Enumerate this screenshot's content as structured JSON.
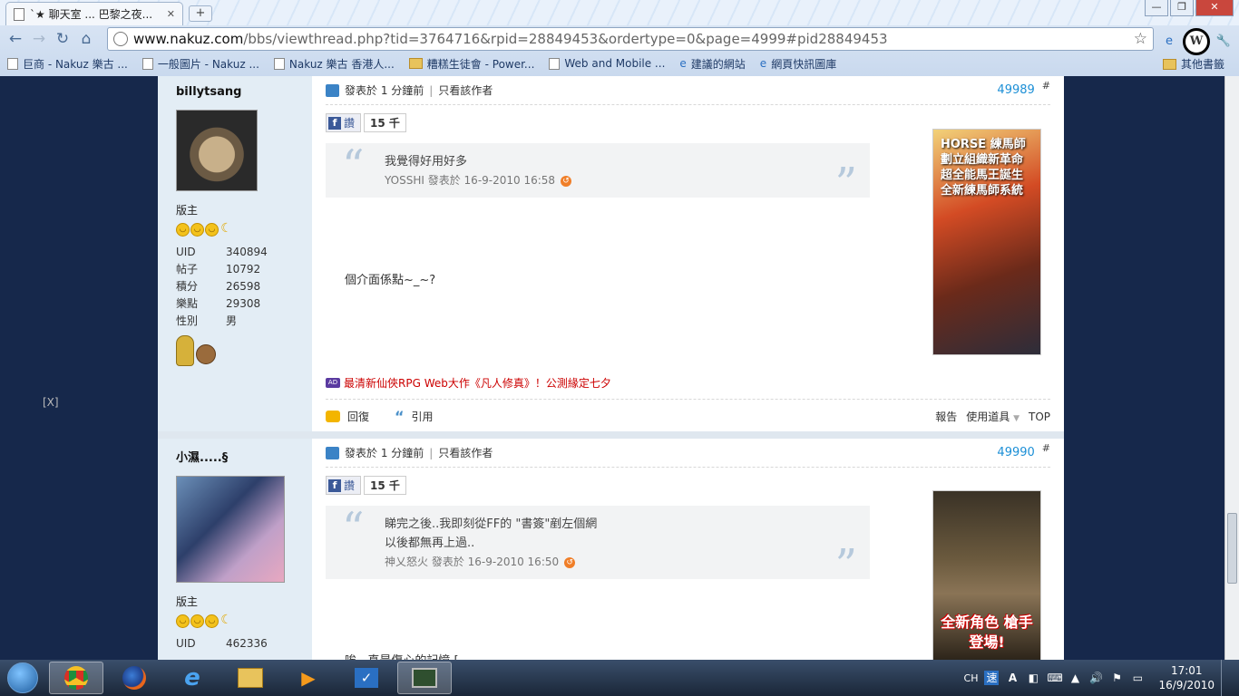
{
  "browser": {
    "tab_title": "`★ 聊天室 ... 巴黎之夜...",
    "url_host": "www.nakuz.com",
    "url_path": "/bbs/viewthread.php?tid=3764716&rpid=28849453&ordertype=0&page=4999#pid28849453",
    "bookmarks": [
      "巨商 - Nakuz 樂古 ...",
      "一般圖片 - Nakuz ...",
      "Nakuz 樂古 香港人...",
      "糟糕生徒會 - Power...",
      "Web and Mobile ...",
      "建議的網站",
      "網頁快訊圖庫"
    ],
    "other_bookmarks": "其他書籤",
    "wiki_label": "W"
  },
  "page": {
    "close_ad": "[X]",
    "posts": [
      {
        "username": "billytsang",
        "role": "版主",
        "stats": [
          {
            "k": "UID",
            "v": "340894"
          },
          {
            "k": "帖子",
            "v": "10792"
          },
          {
            "k": "積分",
            "v": "26598"
          },
          {
            "k": "樂點",
            "v": "29308"
          },
          {
            "k": "性別",
            "v": "男"
          }
        ],
        "posted": "發表於 1 分鐘前",
        "author_only": "只看該作者",
        "floor": "49989",
        "hash": "#",
        "like_label": "讚",
        "like_count": "15 千",
        "quote_lines": [
          "我覺得好用好多"
        ],
        "quote_meta": "YOSSHI  發表於  16-9-2010 16:58",
        "body": "個介面係點~_~?",
        "ad_text": "最清新仙俠RPG Web大作《凡人修真》！公測緣定七夕",
        "ad_badge": "AD",
        "reply": "回復",
        "quote": "引用",
        "report": "報告",
        "tools": "使用道具",
        "top": "TOP",
        "banner_text": "HORSE 練馬師 劃立組織新革命 超全能馬王誕生 全新練馬師系統"
      },
      {
        "username": "小濕.....§",
        "role": "版主",
        "stats": [
          {
            "k": "UID",
            "v": "462336"
          }
        ],
        "posted": "發表於 1 分鐘前",
        "author_only": "只看該作者",
        "floor": "49990",
        "hash": "#",
        "like_label": "讚",
        "like_count": "15 千",
        "quote_lines": [
          "睇完之後..我即刻從FF的 \"書簽\"剷左個網",
          "以後都無再上過.."
        ],
        "quote_meta": "神乂怒火  發表於  16-9-2010 16:50",
        "body": "唉...真是傷心的記憶 [",
        "banner_text": "全新角色 槍手登場!"
      }
    ]
  },
  "taskbar": {
    "lang": "CH",
    "time": "17:01",
    "date": "16/9/2010"
  }
}
